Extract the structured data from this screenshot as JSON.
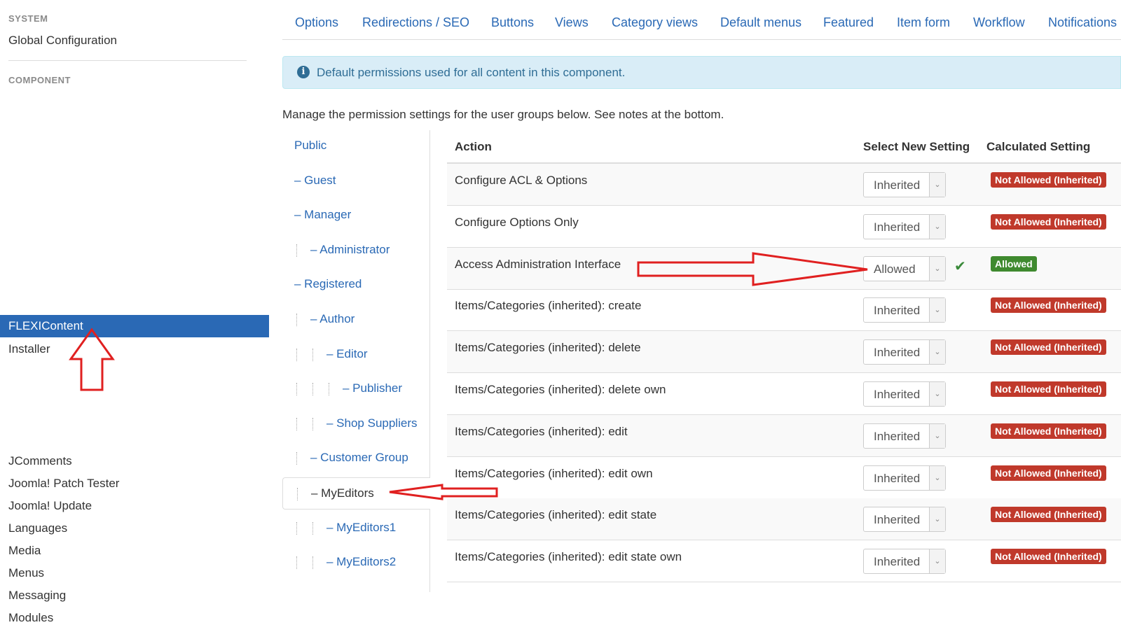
{
  "sidebar": {
    "system_heading": "SYSTEM",
    "global_configuration": "Global Configuration",
    "component_heading": "COMPONENT",
    "active_item": "FLEXIContent",
    "items": [
      "Installer",
      "JComments",
      "Joomla! Patch Tester",
      "Joomla! Update",
      "Languages",
      "Media",
      "Menus",
      "Messaging",
      "Modules"
    ]
  },
  "tabs": [
    "Options",
    "Redirections / SEO",
    "Buttons",
    "Views",
    "Category views",
    "Default menus",
    "Featured",
    "Item form",
    "Workflow",
    "Notifications"
  ],
  "alert": {
    "icon": "info-icon",
    "text": "Default permissions used for all content in this component."
  },
  "manage_text": "Manage the permission settings for the user groups below. See notes at the bottom.",
  "groups": [
    {
      "label": "Public",
      "level": 0,
      "active": false
    },
    {
      "label": "– Guest",
      "level": 0,
      "active": false
    },
    {
      "label": "– Manager",
      "level": 0,
      "active": false
    },
    {
      "label": "– Administrator",
      "level": 1,
      "active": false
    },
    {
      "label": "– Registered",
      "level": 0,
      "active": false
    },
    {
      "label": "– Author",
      "level": 1,
      "active": false
    },
    {
      "label": "– Editor",
      "level": 2,
      "active": false
    },
    {
      "label": "– Publisher",
      "level": 3,
      "active": false
    },
    {
      "label": "– Shop Suppliers",
      "level": 2,
      "active": false
    },
    {
      "label": "– Customer Group",
      "level": 1,
      "active": false
    },
    {
      "label": "– MyEditors",
      "level": 1,
      "active": true
    },
    {
      "label": "– MyEditors1",
      "level": 2,
      "active": false
    },
    {
      "label": "– MyEditors2",
      "level": 2,
      "active": false
    }
  ],
  "table": {
    "headers": {
      "action": "Action",
      "select_new_setting": "Select New Setting",
      "calculated_setting": "Calculated Setting"
    },
    "rows": [
      {
        "action": "Configure ACL & Options",
        "setting": "Inherited",
        "calculated": "Not Allowed (Inherited)",
        "status": "not-allowed",
        "saved": false
      },
      {
        "action": "Configure Options Only",
        "setting": "Inherited",
        "calculated": "Not Allowed (Inherited)",
        "status": "not-allowed",
        "saved": false
      },
      {
        "action": "Access Administration Interface",
        "setting": "Allowed",
        "calculated": "Allowed",
        "status": "allowed",
        "saved": true
      },
      {
        "action": "Items/Categories (inherited): create",
        "setting": "Inherited",
        "calculated": "Not Allowed (Inherited)",
        "status": "not-allowed",
        "saved": false
      },
      {
        "action": "Items/Categories (inherited): delete",
        "setting": "Inherited",
        "calculated": "Not Allowed (Inherited)",
        "status": "not-allowed",
        "saved": false
      },
      {
        "action": "Items/Categories (inherited): delete own",
        "setting": "Inherited",
        "calculated": "Not Allowed (Inherited)",
        "status": "not-allowed",
        "saved": false
      },
      {
        "action": "Items/Categories (inherited): edit",
        "setting": "Inherited",
        "calculated": "Not Allowed (Inherited)",
        "status": "not-allowed",
        "saved": false
      },
      {
        "action": "Items/Categories (inherited): edit own",
        "setting": "Inherited",
        "calculated": "Not Allowed (Inherited)",
        "status": "not-allowed",
        "saved": false
      },
      {
        "action": "Items/Categories (inherited): edit state",
        "setting": "Inherited",
        "calculated": "Not Allowed (Inherited)",
        "status": "not-allowed",
        "saved": false
      },
      {
        "action": "Items/Categories (inherited): edit state own",
        "setting": "Inherited",
        "calculated": "Not Allowed (Inherited)",
        "status": "not-allowed",
        "saved": false
      }
    ]
  },
  "colors": {
    "link": "#2a69b5",
    "active_bg": "#2a69b5",
    "not_allowed": "#c0392b",
    "allowed": "#3f8a2f",
    "annotation": "#e02020"
  }
}
